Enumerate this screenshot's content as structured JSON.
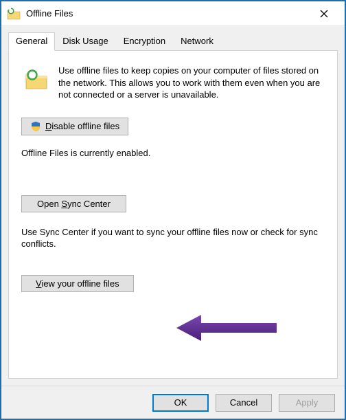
{
  "window": {
    "title": "Offline Files"
  },
  "tabs": [
    {
      "label": "General",
      "active": true
    },
    {
      "label": "Disk Usage",
      "active": false
    },
    {
      "label": "Encryption",
      "active": false
    },
    {
      "label": "Network",
      "active": false
    }
  ],
  "general": {
    "intro": "Use offline files to keep copies on your computer of files stored on the network.  This allows you to work with them even when you are not connected or a server is unavailable.",
    "disable_button": "Disable offline files",
    "status_text": "Offline Files is currently enabled.",
    "sync_button": "Open Sync Center",
    "sync_desc": "Use Sync Center if you want to sync your offline files now or check for sync conflicts.",
    "view_button": "View your offline files"
  },
  "buttons": {
    "ok": "OK",
    "cancel": "Cancel",
    "apply": "Apply"
  },
  "annotation": {
    "arrow_color": "#5e2b97"
  }
}
